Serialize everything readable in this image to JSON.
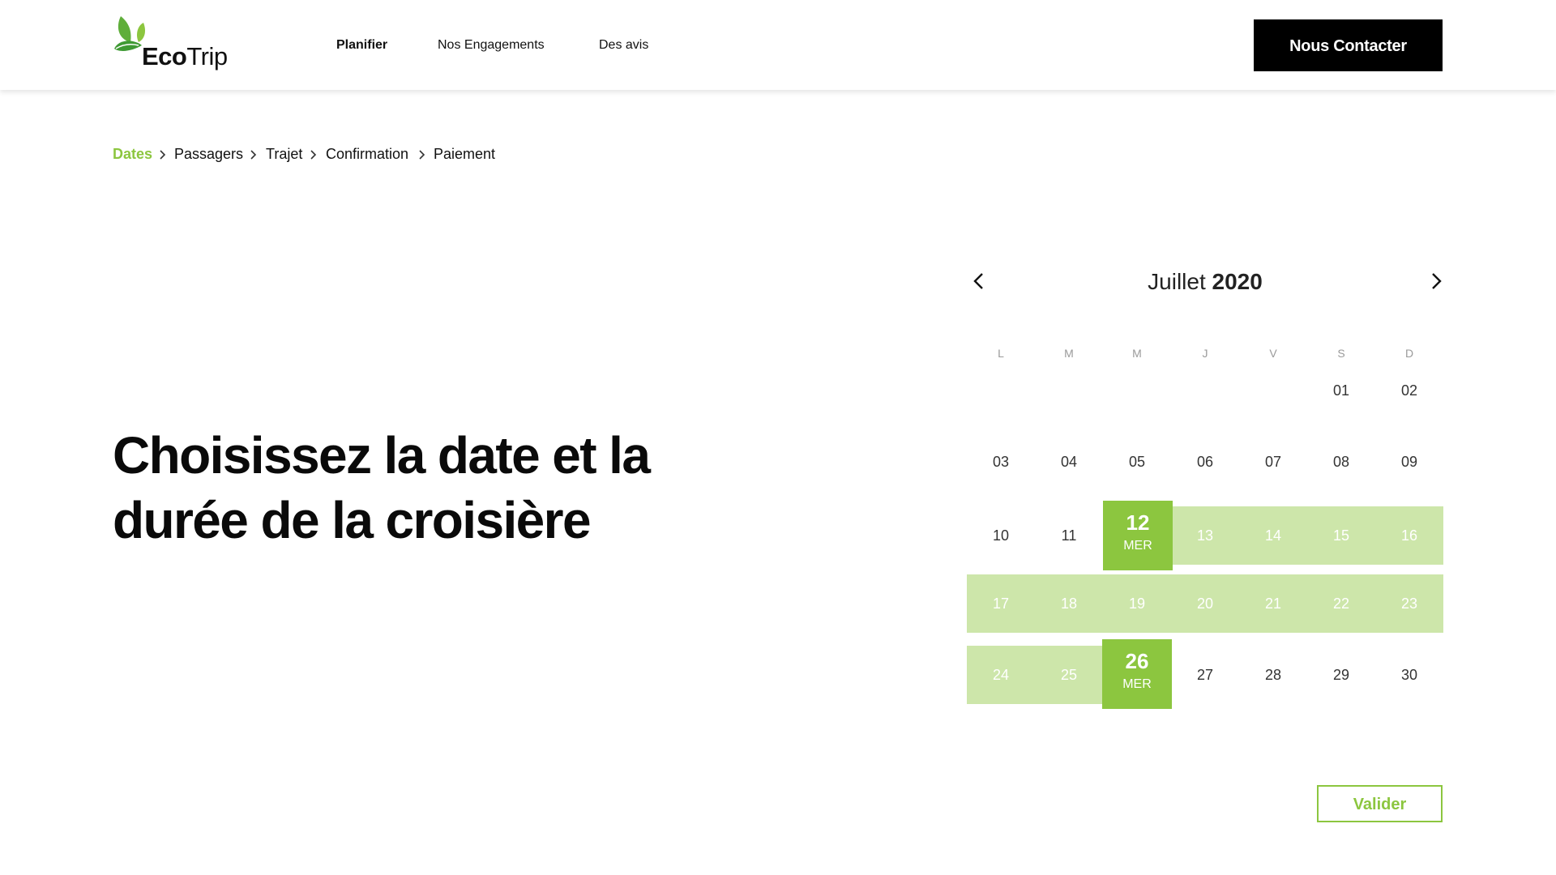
{
  "header": {
    "logo": {
      "text_bold": "Eco",
      "text_regular": "Trip"
    },
    "nav": [
      {
        "label": "Planifier",
        "active": true
      },
      {
        "label": "Nos Engagements",
        "active": false
      },
      {
        "label": "Des avis",
        "active": false
      }
    ],
    "contact_label": "Nous Contacter"
  },
  "breadcrumb": [
    {
      "label": "Dates",
      "active": true
    },
    {
      "label": "Passagers",
      "active": false
    },
    {
      "label": "Trajet",
      "active": false
    },
    {
      "label": "Confirmation",
      "active": false
    },
    {
      "label": "Paiement",
      "active": false
    }
  ],
  "main": {
    "title": "Choisissez la date et la durée de la croisière"
  },
  "calendar": {
    "month": "Juillet",
    "year": "2020",
    "weekdays": [
      "L",
      "M",
      "M",
      "J",
      "V",
      "S",
      "D"
    ],
    "weeks": [
      [
        "",
        "",
        "",
        "",
        "",
        "01",
        "02"
      ],
      [
        "03",
        "04",
        "05",
        "06",
        "07",
        "08",
        "09"
      ],
      [
        "10",
        "11",
        "12",
        "13",
        "14",
        "15",
        "16"
      ],
      [
        "17",
        "18",
        "19",
        "20",
        "21",
        "22",
        "23"
      ],
      [
        "24",
        "25",
        "26",
        "27",
        "28",
        "29",
        "30"
      ]
    ],
    "start": {
      "day": "12",
      "weekday": "MER"
    },
    "end": {
      "day": "26",
      "weekday": "MER"
    },
    "range_days": [
      "13",
      "14",
      "15",
      "16",
      "17",
      "18",
      "19",
      "20",
      "21",
      "22",
      "23",
      "24",
      "25"
    ]
  },
  "validate_label": "Valider",
  "colors": {
    "accent": "#8cc63f",
    "range": "#cde6aa",
    "button_dark": "#000000"
  },
  "icons": [
    "leaf-logo-icon",
    "chevron-right-icon",
    "chevron-left-icon"
  ]
}
